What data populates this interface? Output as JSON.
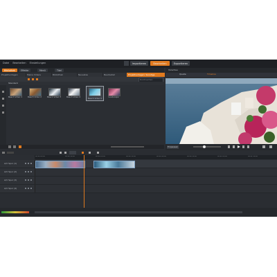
{
  "menu": [
    "Datei",
    "Bearbeiten",
    "Einstellungen"
  ],
  "modes": {
    "import": "Importieren",
    "edit": "Bearbeiten",
    "export": "Exportieren"
  },
  "tabs": [
    {
      "label": "Bibliothek"
    },
    {
      "label": "Effekte"
    },
    {
      "label": "Menü"
    },
    {
      "label": "Titel"
    }
  ],
  "subtabs": [
    "Projektvorlagen",
    "Meine Videos",
    "Bibliothek",
    "Neuestes",
    "Bearbeitet",
    "Projektvorlagen: Sonstige"
  ],
  "library_label": "Standard",
  "search_placeholder": "Durchsuchen",
  "clips": [
    {
      "caption": "Beach Video 1"
    },
    {
      "caption": "Beach Video 2"
    },
    {
      "caption": "Beach Video 3"
    },
    {
      "caption": "Beach Video 4"
    },
    {
      "caption": "Beach Video 5"
    },
    {
      "caption": "Landscape"
    }
  ],
  "preview": {
    "top_label": "Vorschau",
    "tabs": [
      "Quelle",
      "Timeline"
    ],
    "zoom": "Einpassen",
    "timecode": "00:00:00.00"
  },
  "timeline": {
    "tracks": [
      {
        "name": "A/V Spur (1)"
      },
      {
        "name": "A/V Spur (2)"
      },
      {
        "name": "A/V Spur (3)"
      },
      {
        "name": "A/V Spur (4)"
      }
    ],
    "ruler": [
      "00:00:00.00",
      "00:00:10.00",
      "00:00:20.00",
      "00:00:30.00",
      "00:00:40.00",
      "00:00:50.00",
      "00:01:00.00",
      "00:01:10.00"
    ]
  },
  "colors": {
    "accent": "#e07a1f",
    "selected": "#d9642c",
    "panel": "#2b2e33"
  }
}
